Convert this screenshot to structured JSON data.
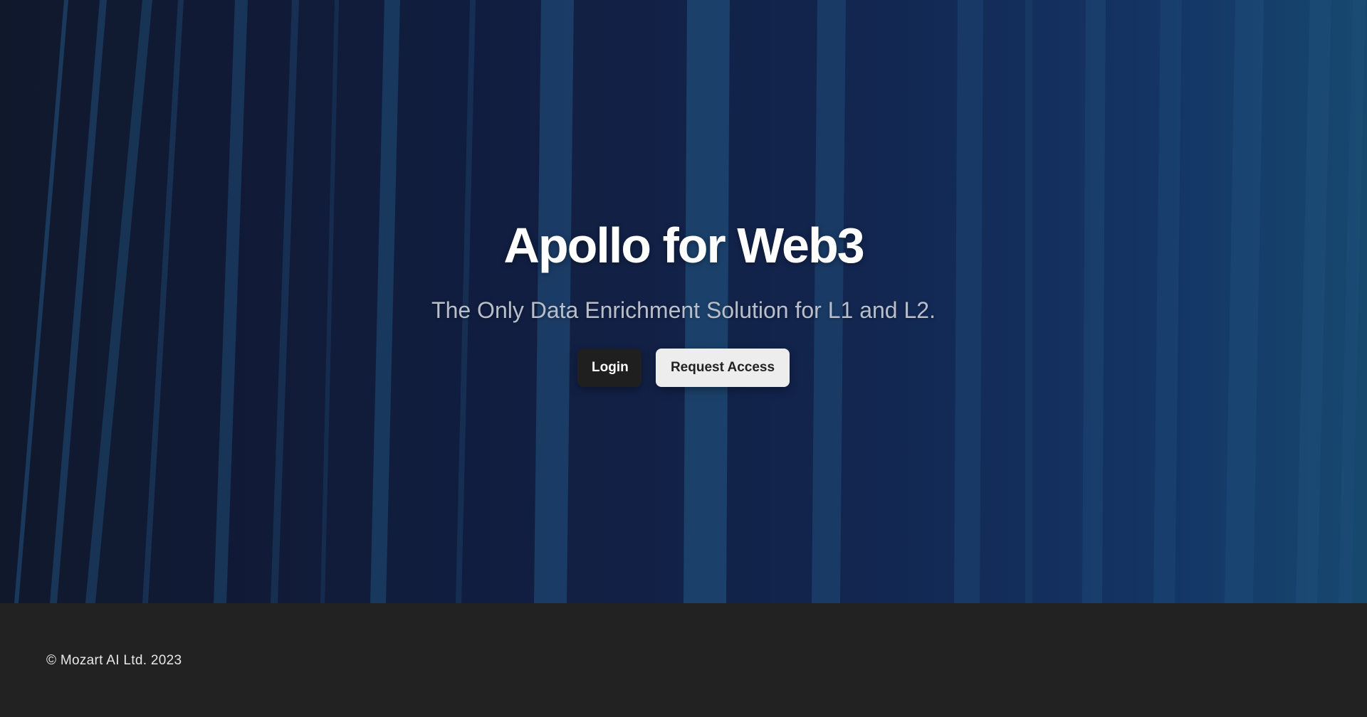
{
  "hero": {
    "title": "Apollo for Web3",
    "subtitle": "The Only Data Enrichment Solution for L1 and L2.",
    "login_label": "Login",
    "request_access_label": "Request Access"
  },
  "footer": {
    "copyright": "© Mozart AI Ltd. 2023"
  },
  "colors": {
    "footer_bg": "#222222",
    "login_bg": "#1f1f1f",
    "request_bg": "#ededed",
    "stripe": "#2a6aa0"
  }
}
